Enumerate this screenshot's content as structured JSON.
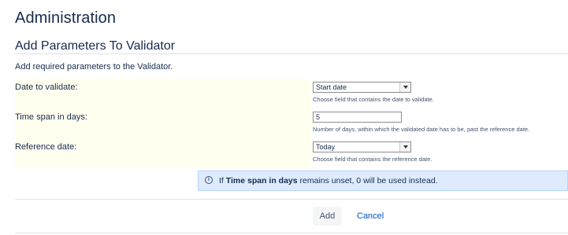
{
  "page": {
    "title": "Administration"
  },
  "section": {
    "title": "Add Parameters To Validator",
    "description": "Add required parameters to the Validator."
  },
  "fields": [
    {
      "label": "Date to validate:",
      "control": "select",
      "value": "Start date",
      "help": "Choose field that contains the date to validate."
    },
    {
      "label": "Time span in days:",
      "control": "text",
      "value": "5",
      "help": "Number of days, within which the validated date has to be, past the reference date."
    },
    {
      "label": "Reference date:",
      "control": "select",
      "value": "Today",
      "help": "Choose field that contains the reference date."
    }
  ],
  "info": {
    "icon": "info-icon",
    "prefix": "If ",
    "bold": "Time span in days",
    "suffix": " remains unset, 0 will be used instead."
  },
  "actions": {
    "add_label": "Add",
    "cancel_label": "Cancel"
  },
  "colors": {
    "label_background": "#fffff0",
    "info_background": "#deebff",
    "link": "#0052cc"
  }
}
